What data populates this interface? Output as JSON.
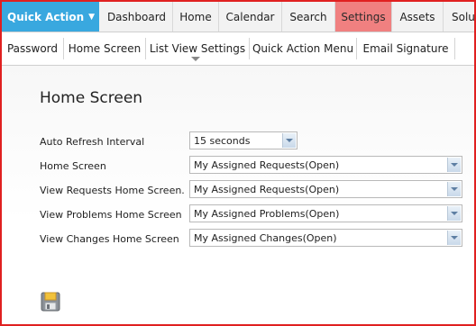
{
  "topnav": {
    "quick_action": "Quick Action",
    "items": [
      "Dashboard",
      "Home",
      "Calendar",
      "Search",
      "Settings",
      "Assets",
      "Solu"
    ]
  },
  "subnav": {
    "items": [
      "Password",
      "Home Screen",
      "List View Settings",
      "Quick Action Menu",
      "Email Signature"
    ]
  },
  "page": {
    "title": "Home Screen"
  },
  "settings": [
    {
      "label": "Auto Refresh Interval",
      "value": "15 seconds"
    },
    {
      "label": "Home Screen",
      "value": "My Assigned Requests(Open)"
    },
    {
      "label": "View Requests Home Screen.",
      "value": "My Assigned Requests(Open)"
    },
    {
      "label": "View Problems Home Screen",
      "value": "My Assigned Problems(Open)"
    },
    {
      "label": "View Changes Home Screen",
      "value": "My Assigned Changes(Open)"
    }
  ],
  "icons": {
    "save": "save-icon",
    "caret": "caret-down-icon"
  },
  "colors": {
    "quick_action_bg": "#39a8df",
    "settings_active": "#f08080",
    "frame_border": "#e02020"
  }
}
